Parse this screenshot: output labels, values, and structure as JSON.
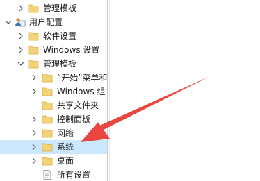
{
  "tree": {
    "items": [
      {
        "label": "管理模板",
        "icon": "folder-icon"
      },
      {
        "label": "用户配置",
        "icon": "user-config-icon"
      },
      {
        "label": "软件设置",
        "icon": "folder-icon"
      },
      {
        "label": "Windows 设置",
        "icon": "folder-icon"
      },
      {
        "label": "管理模板",
        "icon": "folder-icon"
      },
      {
        "label": "“开始”菜单和",
        "icon": "folder-icon"
      },
      {
        "label": "Windows 组",
        "icon": "folder-icon"
      },
      {
        "label": "共享文件夹",
        "icon": "folder-icon"
      },
      {
        "label": "控制面板",
        "icon": "folder-icon"
      },
      {
        "label": "网络",
        "icon": "folder-icon"
      },
      {
        "label": "系统",
        "icon": "folder-icon"
      },
      {
        "label": "桌面",
        "icon": "folder-icon"
      },
      {
        "label": "所有设置",
        "icon": "settings-page-icon"
      }
    ]
  },
  "colors": {
    "selection": "#cce8ff",
    "folder": "#f3d37a",
    "annotation_arrow": "#e8463f"
  }
}
